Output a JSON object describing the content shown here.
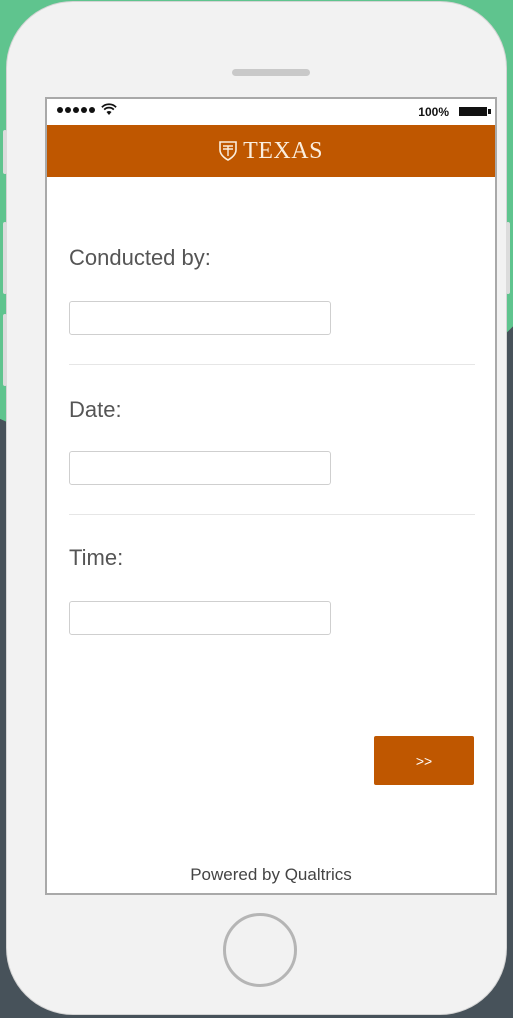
{
  "status_bar": {
    "battery": "100%"
  },
  "header": {
    "brand": "TEXAS",
    "color": "#bf5700"
  },
  "form": {
    "fields": [
      {
        "label": "Conducted by:",
        "value": ""
      },
      {
        "label": "Date:",
        "value": ""
      },
      {
        "label": "Time:",
        "value": ""
      }
    ],
    "next_label": ">>"
  },
  "footer": {
    "text": "Powered by Qualtrics"
  },
  "icons": [
    "signal-dots-icon",
    "wifi-icon",
    "battery-icon",
    "texas-shield-icon",
    "home-button"
  ]
}
